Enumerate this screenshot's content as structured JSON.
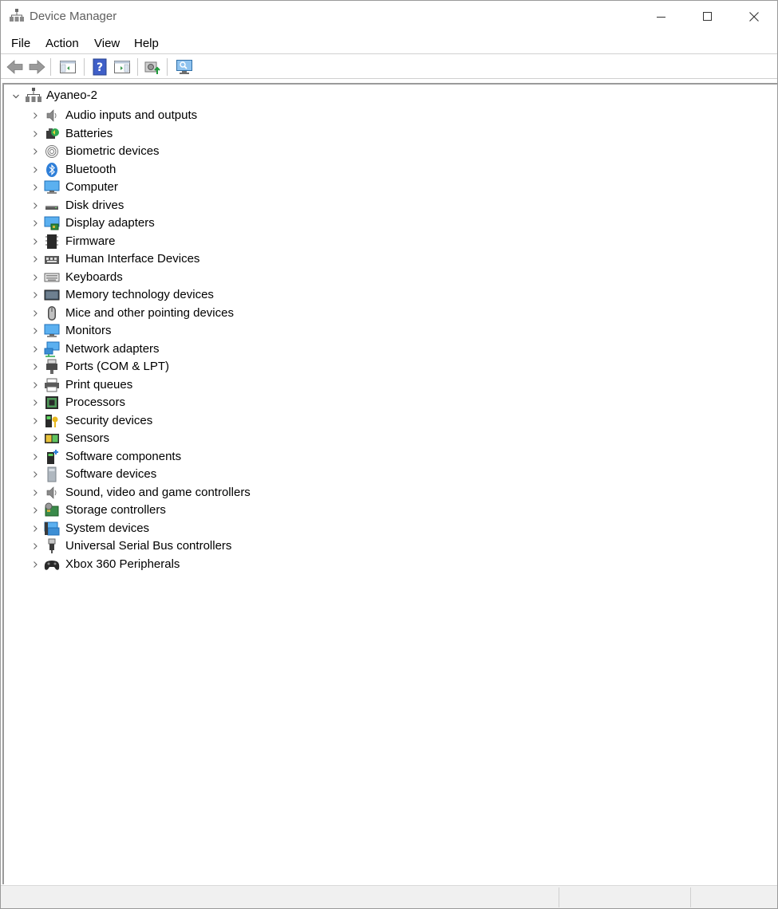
{
  "window": {
    "title": "Device Manager"
  },
  "menu": [
    "File",
    "Action",
    "View",
    "Help"
  ],
  "tree": {
    "root": "Ayaneo-2",
    "items": [
      {
        "label": "Audio inputs and outputs",
        "icon": "speaker-icon"
      },
      {
        "label": "Batteries",
        "icon": "battery-icon"
      },
      {
        "label": "Biometric devices",
        "icon": "fingerprint-icon"
      },
      {
        "label": "Bluetooth",
        "icon": "bluetooth-icon"
      },
      {
        "label": "Computer",
        "icon": "computer-icon"
      },
      {
        "label": "Disk drives",
        "icon": "disk-drive-icon"
      },
      {
        "label": "Display adapters",
        "icon": "display-adapter-icon"
      },
      {
        "label": "Firmware",
        "icon": "firmware-icon"
      },
      {
        "label": "Human Interface Devices",
        "icon": "hid-icon"
      },
      {
        "label": "Keyboards",
        "icon": "keyboard-icon"
      },
      {
        "label": "Memory technology devices",
        "icon": "memory-icon"
      },
      {
        "label": "Mice and other pointing devices",
        "icon": "mouse-icon"
      },
      {
        "label": "Monitors",
        "icon": "monitor-icon"
      },
      {
        "label": "Network adapters",
        "icon": "network-icon"
      },
      {
        "label": "Ports (COM & LPT)",
        "icon": "port-icon"
      },
      {
        "label": "Print queues",
        "icon": "printer-icon"
      },
      {
        "label": "Processors",
        "icon": "processor-icon"
      },
      {
        "label": "Security devices",
        "icon": "security-icon"
      },
      {
        "label": "Sensors",
        "icon": "sensor-icon"
      },
      {
        "label": "Software components",
        "icon": "software-component-icon"
      },
      {
        "label": "Software devices",
        "icon": "software-device-icon"
      },
      {
        "label": "Sound, video and game controllers",
        "icon": "sound-icon"
      },
      {
        "label": "Storage controllers",
        "icon": "storage-controller-icon"
      },
      {
        "label": "System devices",
        "icon": "system-device-icon"
      },
      {
        "label": "Universal Serial Bus controllers",
        "icon": "usb-icon"
      },
      {
        "label": "Xbox 360 Peripherals",
        "icon": "gamepad-icon"
      }
    ]
  }
}
